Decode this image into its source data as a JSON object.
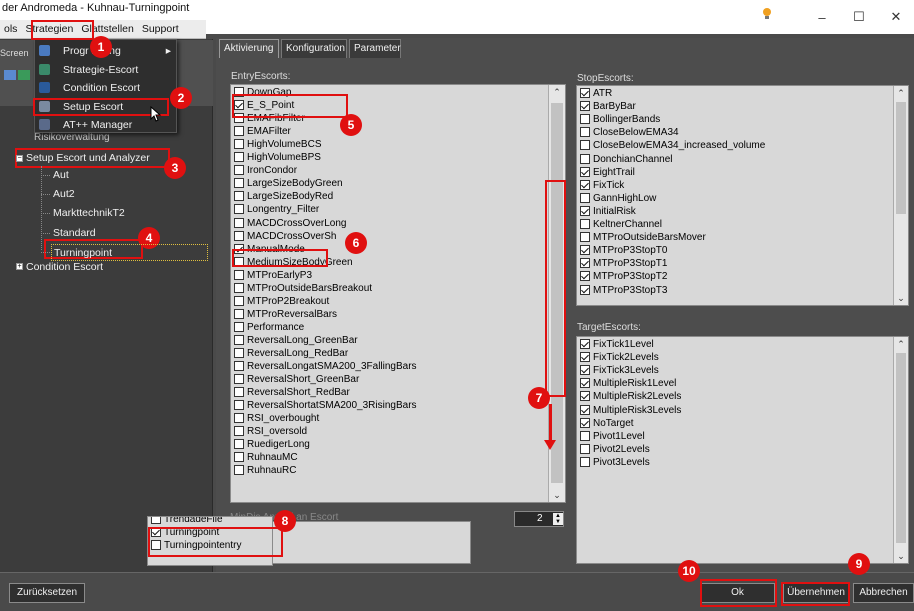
{
  "window": {
    "title": "der Andromeda - Kuhnau-Turningpoint",
    "minimize_glyph": "–",
    "maximize_glyph": "☐",
    "close_glyph": "✕"
  },
  "menubar": [
    "ols",
    "Strategien",
    "Glattstellen",
    "Support"
  ],
  "dropdown": [
    {
      "label": "Progr     ierung",
      "icon": "program-icon",
      "arrow": "▸"
    },
    {
      "label": "Strategie-Escort",
      "icon": "strategy-icon"
    },
    {
      "label": "Condition Escort",
      "icon": "condition-icon"
    },
    {
      "label": "Setup Escort",
      "icon": "setup-icon"
    },
    {
      "label": "AT++ Manager",
      "icon": "manager-icon"
    }
  ],
  "sidebar": {
    "partial_top": "Screen",
    "partial_item": "Risikoverwaltung",
    "setup_group": "Setup Escort und Analyzer",
    "setup_children": [
      "Aut",
      "Aut2",
      "MarkttechnikT2",
      "Standard",
      "Turningpoint"
    ],
    "condition_group": "Condition Escort",
    "bottom_list": [
      "TrendadeFile",
      "Turningpoint",
      "Turningpointentry"
    ],
    "bottom_checked": [
      false,
      true,
      false
    ]
  },
  "tabs": [
    "Aktivierung",
    "Konfiguration",
    "Parameter"
  ],
  "entry": {
    "label": "EntryEscorts:",
    "items": [
      {
        "label": "DownGap",
        "checked": false
      },
      {
        "label": "E_S_Point",
        "checked": true
      },
      {
        "label": "EMAFibFilter",
        "checked": false
      },
      {
        "label": "EMAFilter",
        "checked": false
      },
      {
        "label": "HighVolumeBCS",
        "checked": false
      },
      {
        "label": "HighVolumeBPS",
        "checked": false
      },
      {
        "label": "IronCondor",
        "checked": false
      },
      {
        "label": "LargeSizeBodyGreen",
        "checked": false
      },
      {
        "label": "LargeSizeBodyRed",
        "checked": false
      },
      {
        "label": "Longentry_Filter",
        "checked": false
      },
      {
        "label": "MACDCrossOverLong",
        "checked": false
      },
      {
        "label": "MACDCrossOverSh",
        "checked": false
      },
      {
        "label": "ManualMode",
        "checked": true
      },
      {
        "label": "MediumSizeBodyGreen",
        "checked": false
      },
      {
        "label": "MTProEarlyP3",
        "checked": false
      },
      {
        "label": "MTProOutsideBarsBreakout",
        "checked": false
      },
      {
        "label": "MTProP2Breakout",
        "checked": false
      },
      {
        "label": "MTProReversalBars",
        "checked": false
      },
      {
        "label": "Performance",
        "checked": false
      },
      {
        "label": "ReversalLong_GreenBar",
        "checked": false
      },
      {
        "label": "ReversalLong_RedBar",
        "checked": false
      },
      {
        "label": "ReversalLongatSMA200_3FallingBars",
        "checked": false
      },
      {
        "label": "ReversalShort_GreenBar",
        "checked": false
      },
      {
        "label": "ReversalShort_RedBar",
        "checked": false
      },
      {
        "label": "ReversalShortatSMA200_3RisingBars",
        "checked": false
      },
      {
        "label": "RSI_overbought",
        "checked": false
      },
      {
        "label": "RSI_oversold",
        "checked": false
      },
      {
        "label": "RuedigerLong",
        "checked": false
      },
      {
        "label": "RuhnauMC",
        "checked": false
      },
      {
        "label": "RuhnauRC",
        "checked": false
      }
    ]
  },
  "lower_label": "MinDis     Anzahl an Escort",
  "stepper_value": "2",
  "stop": {
    "label": "StopEscorts:",
    "items": [
      {
        "label": "ATR",
        "checked": true
      },
      {
        "label": "BarByBar",
        "checked": true
      },
      {
        "label": "BollingerBands",
        "checked": false
      },
      {
        "label": "CloseBelowEMA34",
        "checked": false
      },
      {
        "label": "CloseBelowEMA34_increased_volume",
        "checked": false
      },
      {
        "label": "DonchianChannel",
        "checked": false
      },
      {
        "label": "EightTrail",
        "checked": true
      },
      {
        "label": "FixTick",
        "checked": true
      },
      {
        "label": "GannHighLow",
        "checked": false
      },
      {
        "label": "InitialRisk",
        "checked": true
      },
      {
        "label": "KeltnerChannel",
        "checked": false
      },
      {
        "label": "MTProOutsideBarsMover",
        "checked": false
      },
      {
        "label": "MTProP3StopT0",
        "checked": true
      },
      {
        "label": "MTProP3StopT1",
        "checked": true
      },
      {
        "label": "MTProP3StopT2",
        "checked": true
      },
      {
        "label": "MTProP3StopT3",
        "checked": true
      }
    ]
  },
  "target": {
    "label": "TargetEscorts:",
    "items": [
      {
        "label": "FixTick1Level",
        "checked": true
      },
      {
        "label": "FixTick2Levels",
        "checked": true
      },
      {
        "label": "FixTick3Levels",
        "checked": true
      },
      {
        "label": "MultipleRisk1Level",
        "checked": true
      },
      {
        "label": "MultipleRisk2Levels",
        "checked": true
      },
      {
        "label": "MultipleRisk3Levels",
        "checked": true
      },
      {
        "label": "NoTarget",
        "checked": true
      },
      {
        "label": "Pivot1Level",
        "checked": false
      },
      {
        "label": "Pivot2Levels",
        "checked": false
      },
      {
        "label": "Pivot3Levels",
        "checked": false
      }
    ]
  },
  "buttons": {
    "reset": "Zurücksetzen",
    "ok": "Ok",
    "apply": "Übernehmen",
    "cancel": "Abbrechen"
  },
  "badges": [
    "1",
    "2",
    "3",
    "4",
    "5",
    "6",
    "7",
    "8",
    "9",
    "10"
  ],
  "colors": {
    "marker": "#e01010",
    "panel": "#4d4d4d",
    "list": "#d8d8d8"
  }
}
